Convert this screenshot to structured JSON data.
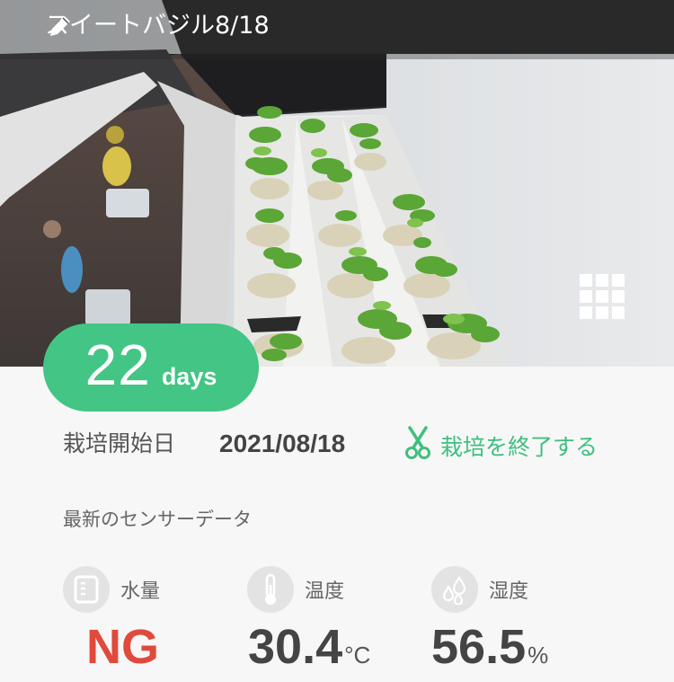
{
  "header": {
    "title": "スイートバジル8/18",
    "edit_icon": "pencil-icon"
  },
  "photo": {
    "menu_icon": "grid-icon"
  },
  "badge": {
    "days": "22",
    "unit": "days",
    "color": "#43c585"
  },
  "cultivation": {
    "start_label": "栽培開始日",
    "start_date": "2021/08/18",
    "end_label": "栽培を終了する",
    "end_icon": "scissors-icon",
    "accent": "#3fbf7f"
  },
  "sensors": {
    "section_title": "最新のセンサーデータ",
    "water": {
      "label": "水量",
      "value": "NG",
      "icon": "water-tank-icon",
      "color": "#e04a3c"
    },
    "temperature": {
      "label": "温度",
      "value": "30.4",
      "unit": "°C",
      "icon": "thermometer-icon"
    },
    "humidity": {
      "label": "湿度",
      "value": "56.5",
      "unit": "%",
      "icon": "droplets-icon"
    }
  }
}
